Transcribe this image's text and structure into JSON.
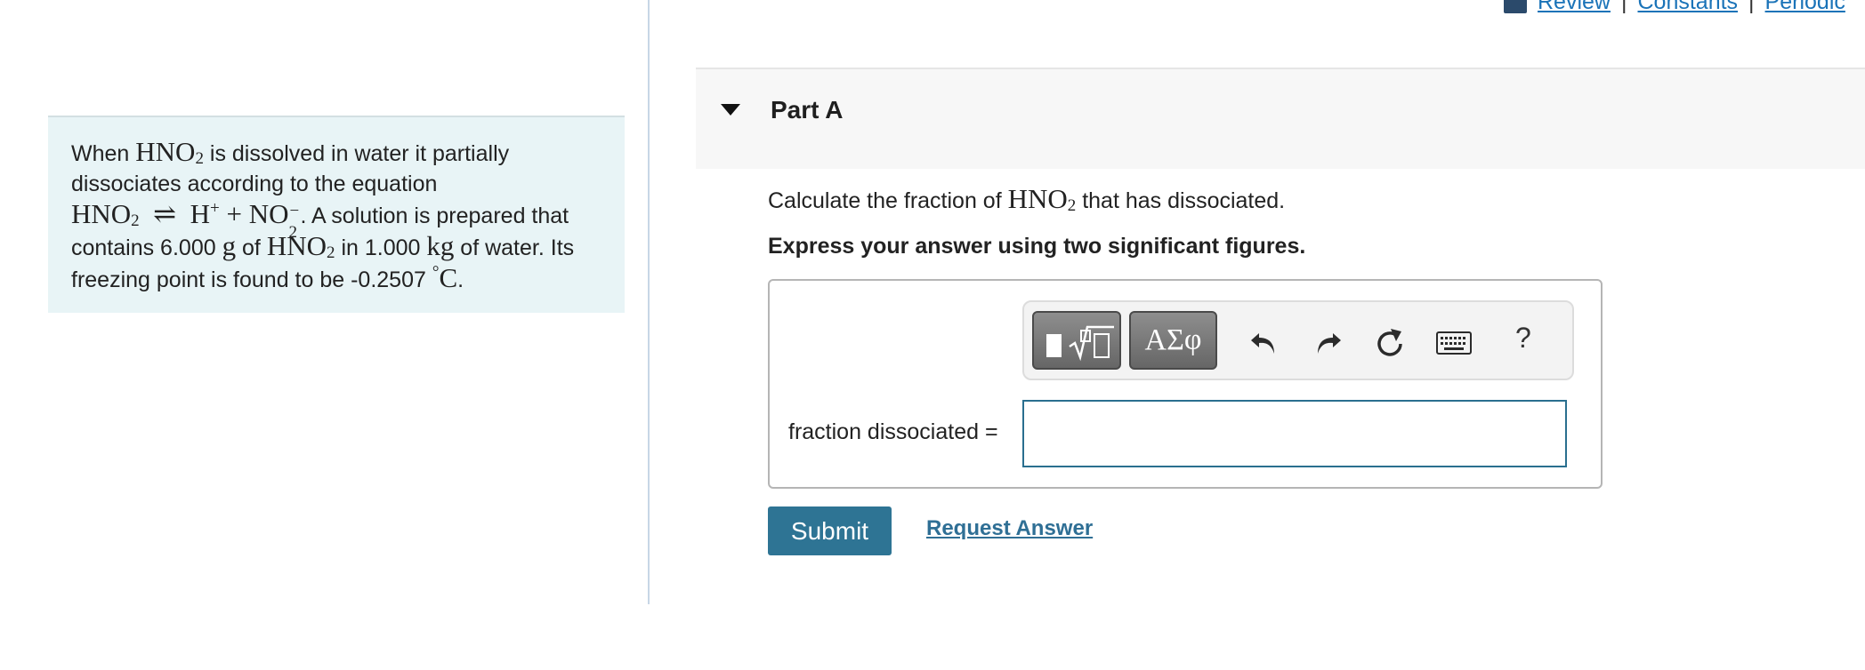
{
  "top_links": {
    "review": "Review",
    "constants": "Constants",
    "periodic": "Periodic",
    "separator": "|"
  },
  "intro": {
    "t1": "When ",
    "m_hno2": "HNO",
    "sub2": "2",
    "t2": " is dissolved in water it partially dissociates according to the equation",
    "eq_h": "H",
    "eq_plus_sup": "+",
    "eq_plus": " + ",
    "eq_no": "NO",
    "eq_minus": "−",
    "equilibrium": "⇌",
    "t3": ". A solution is prepared that contains 6.000 ",
    "unit_g": "g",
    "t4": " of ",
    "t5": " in 1.000 ",
    "unit_kg": "kg",
    "t6": " of water. Its freezing point is found to be -0.2507 ",
    "degree": "°",
    "unit_c": "C",
    "t7": "."
  },
  "part": {
    "title": "Part A"
  },
  "question": {
    "before": "Calculate the fraction of ",
    "after": " that has dissociated."
  },
  "instruction": "Express your answer using two significant figures.",
  "toolbar": {
    "greek_label": "ΑΣφ",
    "help_label": "?"
  },
  "answer": {
    "label": "fraction dissociated =",
    "value": ""
  },
  "actions": {
    "submit_label": "Submit",
    "request_label": "Request Answer"
  },
  "colors": {
    "accent": "#2e7494",
    "link": "#1a73b8",
    "intro_bg": "#e8f4f6"
  }
}
